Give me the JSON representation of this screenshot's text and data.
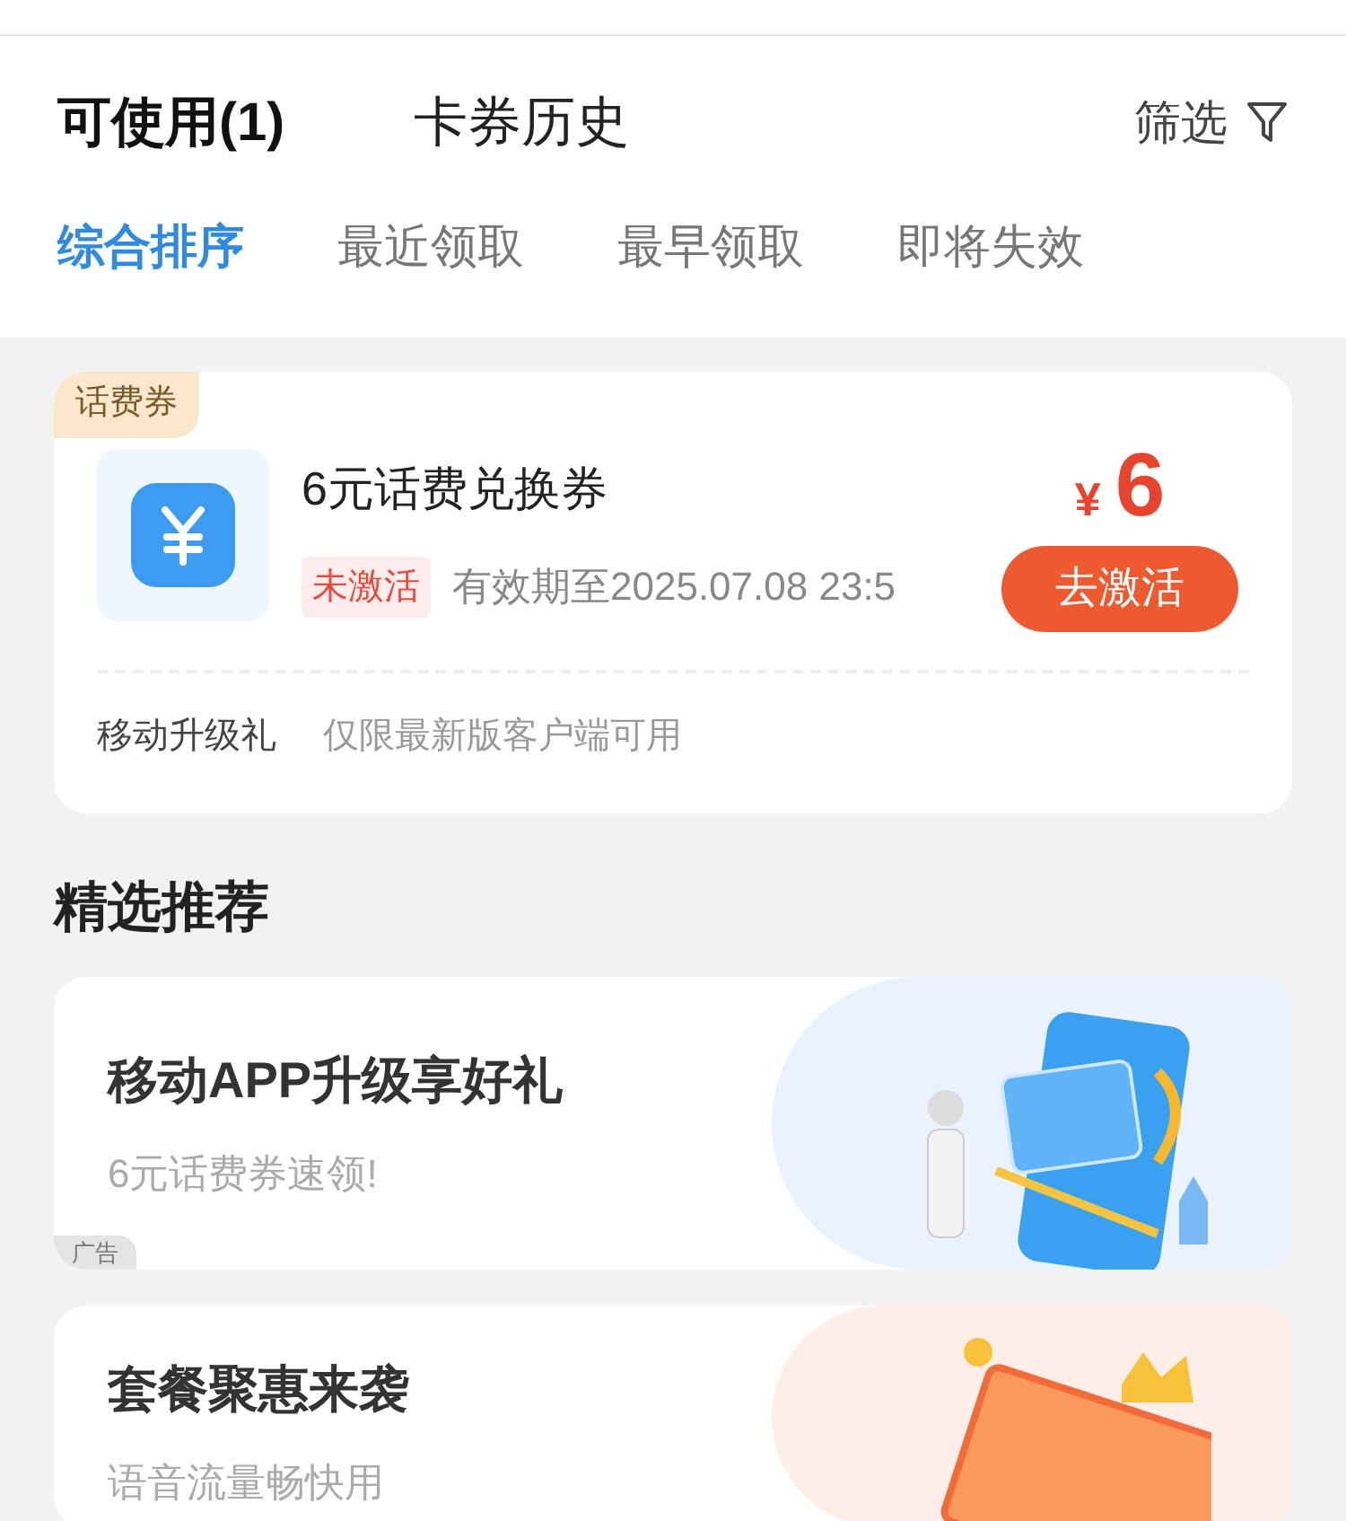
{
  "tabs": [
    {
      "label": "可使用(1)",
      "selected": true
    },
    {
      "label": "卡券历史",
      "selected": false
    }
  ],
  "filter": {
    "label": "筛选"
  },
  "sort_options": [
    {
      "label": "综合排序",
      "selected": true
    },
    {
      "label": "最近领取",
      "selected": false
    },
    {
      "label": "最早领取",
      "selected": false
    },
    {
      "label": "即将失效",
      "selected": false
    }
  ],
  "coupon": {
    "tag": "话费券",
    "title": "6元话费兑换券",
    "status": "未激活",
    "validity": "有效期至2025.07.08 23:5",
    "currency": "¥",
    "amount": "6",
    "action": "去激活",
    "source": "移动升级礼",
    "restriction": "仅限最新版客户端可用"
  },
  "section_title": "精选推荐",
  "banners": [
    {
      "kind": "phone",
      "title": "移动APP升级享好礼",
      "subtitle": "6元话费券速领!",
      "ad_label": "广告"
    },
    {
      "kind": "ticket",
      "title": "套餐聚惠来袭",
      "subtitle": "语音流量畅快用"
    }
  ]
}
